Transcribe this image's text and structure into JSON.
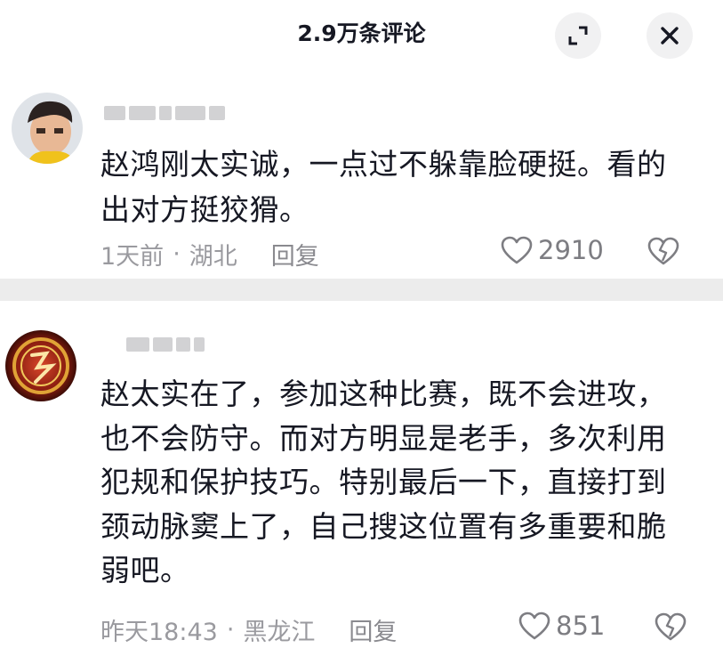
{
  "header": {
    "title": "2.9万条评论",
    "expand_icon": "expand-icon",
    "close_icon": "close-icon"
  },
  "comments": [
    {
      "text": "赵鸿刚太实诚，一点过不躲靠脸硬挺。看的出对方挺狡猾。",
      "time": "1天前",
      "location": "湖北",
      "reply_label": "回复",
      "likes": "2910"
    },
    {
      "text": "赵太实在了，参加这种比赛，既不会进攻，也不会防守。而对方明显是老手，多次利用犯规和保护技巧。特别最后一下，直接打到颈动脉窦上了，自己搜这位置有多重要和脆弱吧。",
      "time": "昨天18:43",
      "location": "黑龙江",
      "reply_label": "回复",
      "likes": "851"
    }
  ],
  "separator": "·"
}
